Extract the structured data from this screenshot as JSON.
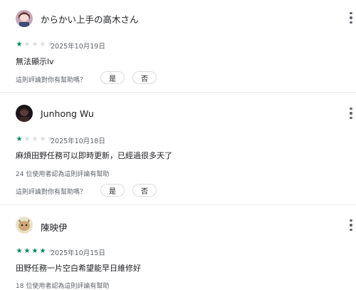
{
  "reviews": [
    {
      "name": "からかい上手の高木さん",
      "avatar_icon": "avatar-anime-girl",
      "rating": 1,
      "date": "2025年10月19日",
      "text": "無法顯示lv",
      "helpful_count": "",
      "question": "這則評論對你有幫助嗎？",
      "yes_label": "是",
      "no_label": "否"
    },
    {
      "name": "Junhong Wu",
      "avatar_icon": "avatar-dark-figure",
      "rating": 1,
      "date": "2025年10月18日",
      "text": "麻煩田野任務可以即時更新，已經過很多天了",
      "helpful_count": "24 位使用者認為這則評論有幫助",
      "question": "這則評論對你有幫助嗎？",
      "yes_label": "是",
      "no_label": "否"
    },
    {
      "name": "陳映伊",
      "avatar_icon": "avatar-pet-photo",
      "rating": 4,
      "date": "2025年10月15日",
      "text": "田野任務一片空白希望能早日維修好",
      "helpful_count": "18 位使用者認為這則評論有幫助"
    }
  ],
  "colors": {
    "star_filled": "#01875f",
    "star_empty": "#dadce0"
  }
}
